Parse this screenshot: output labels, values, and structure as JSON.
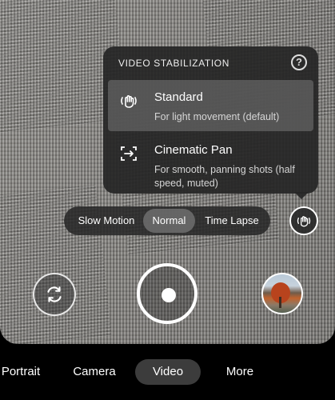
{
  "stabilization": {
    "title": "VIDEO STABILIZATION",
    "options": [
      {
        "title": "Standard",
        "description": "For light movement (default)",
        "selected": true,
        "icon": "hand-shake-icon"
      },
      {
        "title": "Cinematic Pan",
        "description": "For smooth, panning shots (half speed, muted)",
        "selected": false,
        "icon": "pan-arrows-icon"
      }
    ]
  },
  "speed_modes": {
    "items": [
      "Slow Motion",
      "Normal",
      "Time Lapse"
    ],
    "selected": "Normal"
  },
  "bottom_nav": {
    "items": [
      "Portrait",
      "Camera",
      "Video",
      "More"
    ],
    "selected": "Video"
  },
  "colors": {
    "panel_bg": "#262626",
    "selected_bg": "#787878",
    "text": "#ffffff"
  }
}
